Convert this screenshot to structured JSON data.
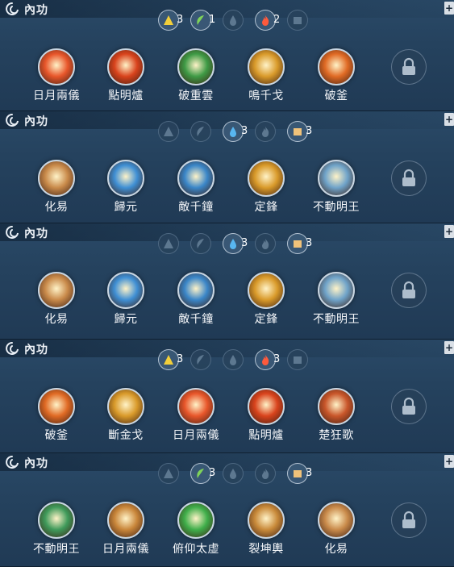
{
  "panels": [
    {
      "title": "內功",
      "elements": [
        {
          "icon": "metal-element-icon",
          "active": true,
          "count": "3"
        },
        {
          "icon": "wood-element-icon",
          "active": true,
          "count": "1"
        },
        {
          "icon": "water-element-icon",
          "active": false,
          "count": ""
        },
        {
          "icon": "fire-element-icon",
          "active": true,
          "count": "2"
        },
        {
          "icon": "earth-element-icon",
          "active": false,
          "count": ""
        }
      ],
      "skills": [
        {
          "name": "日月兩儀",
          "color": "#e8562a"
        },
        {
          "name": "點明爐",
          "color": "#d9431c"
        },
        {
          "name": "破重雲",
          "color": "#3e9a45"
        },
        {
          "name": "鳴千戈",
          "color": "#d99a2a"
        },
        {
          "name": "破釜",
          "color": "#e06a24"
        }
      ]
    },
    {
      "title": "內功",
      "elements": [
        {
          "icon": "metal-element-icon",
          "active": false,
          "count": ""
        },
        {
          "icon": "wood-element-icon",
          "active": false,
          "count": ""
        },
        {
          "icon": "water-element-icon",
          "active": true,
          "count": "3"
        },
        {
          "icon": "fire-element-icon",
          "active": false,
          "count": ""
        },
        {
          "icon": "earth-element-icon",
          "active": true,
          "count": "3"
        }
      ],
      "skills": [
        {
          "name": "化易",
          "color": "#c98a4a"
        },
        {
          "name": "歸元",
          "color": "#3f8fd4"
        },
        {
          "name": "敵千鐘",
          "color": "#3a86c8"
        },
        {
          "name": "定鋒",
          "color": "#d99a2a"
        },
        {
          "name": "不動明王",
          "color": "#6fa3c9"
        }
      ]
    },
    {
      "title": "內功",
      "elements": [
        {
          "icon": "metal-element-icon",
          "active": false,
          "count": ""
        },
        {
          "icon": "wood-element-icon",
          "active": false,
          "count": ""
        },
        {
          "icon": "water-element-icon",
          "active": true,
          "count": "3"
        },
        {
          "icon": "fire-element-icon",
          "active": false,
          "count": ""
        },
        {
          "icon": "earth-element-icon",
          "active": true,
          "count": "3"
        }
      ],
      "skills": [
        {
          "name": "化易",
          "color": "#c98a4a"
        },
        {
          "name": "歸元",
          "color": "#3f8fd4"
        },
        {
          "name": "敵千鐘",
          "color": "#3a86c8"
        },
        {
          "name": "定鋒",
          "color": "#d99a2a"
        },
        {
          "name": "不動明王",
          "color": "#6fa3c9"
        }
      ]
    },
    {
      "title": "內功",
      "elements": [
        {
          "icon": "metal-element-icon",
          "active": true,
          "count": "3"
        },
        {
          "icon": "wood-element-icon",
          "active": false,
          "count": ""
        },
        {
          "icon": "water-element-icon",
          "active": false,
          "count": ""
        },
        {
          "icon": "fire-element-icon",
          "active": true,
          "count": "3"
        },
        {
          "icon": "earth-element-icon",
          "active": false,
          "count": ""
        }
      ],
      "skills": [
        {
          "name": "破釜",
          "color": "#e06a24"
        },
        {
          "name": "斷金戈",
          "color": "#d99a2a"
        },
        {
          "name": "日月兩儀",
          "color": "#e8562a"
        },
        {
          "name": "點明爐",
          "color": "#d9431c"
        },
        {
          "name": "楚狂歌",
          "color": "#c9562a"
        }
      ]
    },
    {
      "title": "內功",
      "elements": [
        {
          "icon": "metal-element-icon",
          "active": false,
          "count": ""
        },
        {
          "icon": "wood-element-icon",
          "active": true,
          "count": "3"
        },
        {
          "icon": "water-element-icon",
          "active": false,
          "count": ""
        },
        {
          "icon": "fire-element-icon",
          "active": false,
          "count": ""
        },
        {
          "icon": "earth-element-icon",
          "active": true,
          "count": "3"
        }
      ],
      "skills": [
        {
          "name": "不動明王",
          "color": "#3f9a5a"
        },
        {
          "name": "日月兩儀",
          "color": "#c9863a"
        },
        {
          "name": "俯仰太虛",
          "color": "#3fae4a"
        },
        {
          "name": "裂坤輿",
          "color": "#c98a3a"
        },
        {
          "name": "化易",
          "color": "#c98a4a"
        }
      ]
    }
  ],
  "element_colors": {
    "metal": "#f2cf3a",
    "wood": "#7fd35a",
    "water": "#58b6f0",
    "fire": "#ff5a3c",
    "earth": "#f0c27a",
    "inactive": "#5d7890"
  }
}
